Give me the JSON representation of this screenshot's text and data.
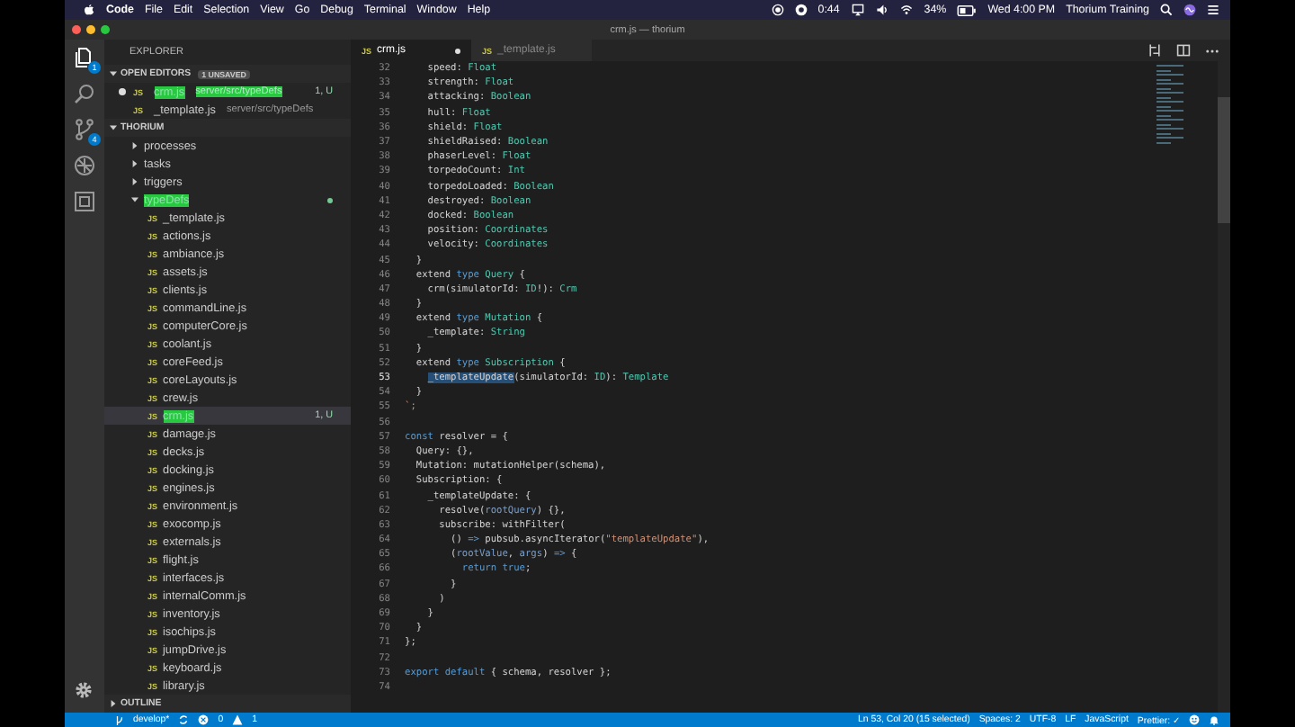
{
  "menubar": {
    "app": "Code",
    "menus": [
      "File",
      "Edit",
      "Selection",
      "View",
      "Go",
      "Debug",
      "Terminal",
      "Window",
      "Help"
    ],
    "timer": "0:44",
    "battery": "34%",
    "clock": "Wed 4:00 PM",
    "user": "Thorium Training"
  },
  "window": {
    "title": "crm.js — thorium"
  },
  "activity_bar": {
    "explorer_badge": "1",
    "source_control_badge": "4"
  },
  "sidebar": {
    "title": "EXPLORER",
    "open_editors": {
      "label": "OPEN EDITORS",
      "expanded": true,
      "badge": "1 UNSAVED",
      "items": [
        {
          "icon": "JS",
          "name": "crm.js",
          "path": "server/src/typeDefs",
          "dirty": true,
          "untracked": true,
          "status": "1, U"
        },
        {
          "icon": "JS",
          "name": "_template.js",
          "path": "server/src/typeDefs",
          "dirty": false,
          "untracked": false
        }
      ]
    },
    "project": {
      "label": "THORIUM",
      "expanded": true,
      "children": [
        {
          "name": "processes",
          "expanded": false,
          "untracked": false
        },
        {
          "name": "tasks",
          "expanded": false,
          "untracked": false
        },
        {
          "name": "triggers",
          "expanded": false,
          "untracked": false
        },
        {
          "name": "typeDefs",
          "expanded": true,
          "untracked": true,
          "children": [
            {
              "icon": "JS",
              "name": "_template.js",
              "selected": false,
              "untracked": false
            },
            {
              "icon": "JS",
              "name": "actions.js",
              "selected": false,
              "untracked": false
            },
            {
              "icon": "JS",
              "name": "ambiance.js",
              "selected": false,
              "untracked": false
            },
            {
              "icon": "JS",
              "name": "assets.js",
              "selected": false,
              "untracked": false
            },
            {
              "icon": "JS",
              "name": "clients.js",
              "selected": false,
              "untracked": false
            },
            {
              "icon": "JS",
              "name": "commandLine.js",
              "selected": false,
              "untracked": false
            },
            {
              "icon": "JS",
              "name": "computerCore.js",
              "selected": false,
              "untracked": false
            },
            {
              "icon": "JS",
              "name": "coolant.js",
              "selected": false,
              "untracked": false
            },
            {
              "icon": "JS",
              "name": "coreFeed.js",
              "selected": false,
              "untracked": false
            },
            {
              "icon": "JS",
              "name": "coreLayouts.js",
              "selected": false,
              "untracked": false
            },
            {
              "icon": "JS",
              "name": "crew.js",
              "selected": false,
              "untracked": false
            },
            {
              "icon": "JS",
              "name": "crm.js",
              "selected": true,
              "untracked": true,
              "status": "1, U"
            },
            {
              "icon": "JS",
              "name": "damage.js",
              "selected": false,
              "untracked": false
            },
            {
              "icon": "JS",
              "name": "decks.js",
              "selected": false,
              "untracked": false
            },
            {
              "icon": "JS",
              "name": "docking.js",
              "selected": false,
              "untracked": false
            },
            {
              "icon": "JS",
              "name": "engines.js",
              "selected": false,
              "untracked": false
            },
            {
              "icon": "JS",
              "name": "environment.js",
              "selected": false,
              "untracked": false
            },
            {
              "icon": "JS",
              "name": "exocomp.js",
              "selected": false,
              "untracked": false
            },
            {
              "icon": "JS",
              "name": "externals.js",
              "selected": false,
              "untracked": false
            },
            {
              "icon": "JS",
              "name": "flight.js",
              "selected": false,
              "untracked": false
            },
            {
              "icon": "JS",
              "name": "interfaces.js",
              "selected": false,
              "untracked": false
            },
            {
              "icon": "JS",
              "name": "internalComm.js",
              "selected": false,
              "untracked": false
            },
            {
              "icon": "JS",
              "name": "inventory.js",
              "selected": false,
              "untracked": false
            },
            {
              "icon": "JS",
              "name": "isochips.js",
              "selected": false,
              "untracked": false
            },
            {
              "icon": "JS",
              "name": "jumpDrive.js",
              "selected": false,
              "untracked": false
            },
            {
              "icon": "JS",
              "name": "keyboard.js",
              "selected": false,
              "untracked": false
            },
            {
              "icon": "JS",
              "name": "library.js",
              "selected": false,
              "untracked": false
            }
          ]
        }
      ]
    },
    "outline": {
      "label": "OUTLINE",
      "expanded": false
    }
  },
  "tabs": [
    {
      "icon": "JS",
      "label": "crm.js",
      "selected": true,
      "dirty": true
    },
    {
      "icon": "JS",
      "label": "_template.js",
      "selected": false,
      "dirty": false
    }
  ],
  "editor": {
    "lines": [
      {
        "number": "32",
        "current": false,
        "tokens": [
          {
            "text": "    speed: ",
            "kind": "plain"
          },
          {
            "text": "Float",
            "kind": "type"
          }
        ]
      },
      {
        "number": "33",
        "current": false,
        "tokens": [
          {
            "text": "    strength: ",
            "kind": "plain"
          },
          {
            "text": "Float",
            "kind": "type"
          }
        ]
      },
      {
        "number": "34",
        "current": false,
        "tokens": [
          {
            "text": "    attacking: ",
            "kind": "plain"
          },
          {
            "text": "Boolean",
            "kind": "type"
          }
        ]
      },
      {
        "number": "35",
        "current": false,
        "tokens": [
          {
            "text": "    hull: ",
            "kind": "plain"
          },
          {
            "text": "Float",
            "kind": "type"
          }
        ]
      },
      {
        "number": "36",
        "current": false,
        "tokens": [
          {
            "text": "    shield: ",
            "kind": "plain"
          },
          {
            "text": "Float",
            "kind": "type"
          }
        ]
      },
      {
        "number": "37",
        "current": false,
        "tokens": [
          {
            "text": "    shieldRaised: ",
            "kind": "plain"
          },
          {
            "text": "Boolean",
            "kind": "type"
          }
        ]
      },
      {
        "number": "38",
        "current": false,
        "tokens": [
          {
            "text": "    phaserLevel: ",
            "kind": "plain"
          },
          {
            "text": "Float",
            "kind": "type"
          }
        ]
      },
      {
        "number": "39",
        "current": false,
        "tokens": [
          {
            "text": "    torpedoCount: ",
            "kind": "plain"
          },
          {
            "text": "Int",
            "kind": "type"
          }
        ]
      },
      {
        "number": "40",
        "current": false,
        "tokens": [
          {
            "text": "    torpedoLoaded: ",
            "kind": "plain"
          },
          {
            "text": "Boolean",
            "kind": "type"
          }
        ]
      },
      {
        "number": "41",
        "current": false,
        "tokens": [
          {
            "text": "    destroyed: ",
            "kind": "plain"
          },
          {
            "text": "Boolean",
            "kind": "type"
          }
        ]
      },
      {
        "number": "42",
        "current": false,
        "tokens": [
          {
            "text": "    docked: ",
            "kind": "plain"
          },
          {
            "text": "Boolean",
            "kind": "type"
          }
        ]
      },
      {
        "number": "43",
        "current": false,
        "tokens": [
          {
            "text": "    position: ",
            "kind": "plain"
          },
          {
            "text": "Coordinates",
            "kind": "type"
          }
        ]
      },
      {
        "number": "44",
        "current": false,
        "tokens": [
          {
            "text": "    velocity: ",
            "kind": "plain"
          },
          {
            "text": "Coordinates",
            "kind": "type"
          }
        ]
      },
      {
        "number": "45",
        "current": false,
        "tokens": [
          {
            "text": "  }",
            "kind": "plain"
          }
        ]
      },
      {
        "number": "46",
        "current": false,
        "tokens": [
          {
            "text": "  extend ",
            "kind": "plain"
          },
          {
            "text": "type",
            "kind": "keyword"
          },
          {
            "text": " Query",
            "kind": "type"
          },
          {
            "text": " {",
            "kind": "plain"
          }
        ]
      },
      {
        "number": "47",
        "current": false,
        "tokens": [
          {
            "text": "    crm(simulatorId: ",
            "kind": "plain"
          },
          {
            "text": "ID",
            "kind": "type"
          },
          {
            "text": "!): ",
            "kind": "plain"
          },
          {
            "text": "Crm",
            "kind": "type"
          }
        ]
      },
      {
        "number": "48",
        "current": false,
        "tokens": [
          {
            "text": "  }",
            "kind": "plain"
          }
        ]
      },
      {
        "number": "49",
        "current": false,
        "tokens": [
          {
            "text": "  extend ",
            "kind": "plain"
          },
          {
            "text": "type",
            "kind": "keyword"
          },
          {
            "text": " Mutation",
            "kind": "type"
          },
          {
            "text": " {",
            "kind": "plain"
          }
        ]
      },
      {
        "number": "50",
        "current": false,
        "tokens": [
          {
            "text": "    _template: ",
            "kind": "plain"
          },
          {
            "text": "String",
            "kind": "type"
          }
        ]
      },
      {
        "number": "51",
        "current": false,
        "tokens": [
          {
            "text": "  }",
            "kind": "plain"
          }
        ]
      },
      {
        "number": "52",
        "current": false,
        "tokens": [
          {
            "text": "  extend ",
            "kind": "plain"
          },
          {
            "text": "type",
            "kind": "keyword"
          },
          {
            "text": " Subscription",
            "kind": "type"
          },
          {
            "text": " {",
            "kind": "plain"
          }
        ]
      },
      {
        "number": "53",
        "current": true,
        "tokens": [
          {
            "text": "    _templateUpdate",
            "kind": "selection"
          },
          {
            "text": "(simulatorId: ",
            "kind": "plain"
          },
          {
            "text": "ID",
            "kind": "type"
          },
          {
            "text": "): ",
            "kind": "plain"
          },
          {
            "text": "Template",
            "kind": "type"
          }
        ]
      },
      {
        "number": "54",
        "current": false,
        "tokens": [
          {
            "text": "  }",
            "kind": "plain"
          }
        ]
      },
      {
        "number": "55",
        "current": false,
        "tokens": [
          {
            "text": "`;",
            "kind": "string"
          }
        ]
      },
      {
        "number": "56",
        "current": false
      },
      {
        "number": "57",
        "current": false,
        "tokens": [
          {
            "text": "const",
            "kind": "keyword"
          },
          {
            "text": " resolver = {",
            "kind": "plain"
          }
        ]
      },
      {
        "number": "58",
        "current": false,
        "tokens": [
          {
            "text": "  Query: {},",
            "kind": "plain"
          }
        ]
      },
      {
        "number": "59",
        "current": false,
        "tokens": [
          {
            "text": "  Mutation: mutationHelper(schema),",
            "kind": "plain"
          }
        ]
      },
      {
        "number": "60",
        "current": false,
        "tokens": [
          {
            "text": "  Subscription: {",
            "kind": "plain"
          }
        ]
      },
      {
        "number": "61",
        "current": false,
        "tokens": [
          {
            "text": "    _templateUpdate: {",
            "kind": "plain"
          }
        ]
      },
      {
        "number": "62",
        "current": false,
        "tokens": [
          {
            "text": "      resolve(",
            "kind": "plain"
          },
          {
            "text": "rootQuery",
            "kind": "param"
          },
          {
            "text": ") {},",
            "kind": "plain"
          }
        ]
      },
      {
        "number": "63",
        "current": false,
        "tokens": [
          {
            "text": "      subscribe: withFilter(",
            "kind": "plain"
          }
        ]
      },
      {
        "number": "64",
        "current": false,
        "tokens": [
          {
            "text": "        () ",
            "kind": "plain"
          },
          {
            "text": "=>",
            "kind": "keyword"
          },
          {
            "text": " pubsub.asyncIterator(",
            "kind": "plain"
          },
          {
            "text": "\"templateUpdate\"",
            "kind": "string"
          },
          {
            "text": "),",
            "kind": "plain"
          }
        ]
      },
      {
        "number": "65",
        "current": false,
        "tokens": [
          {
            "text": "        (",
            "kind": "plain"
          },
          {
            "text": "rootValue",
            "kind": "param"
          },
          {
            "text": ", ",
            "kind": "plain"
          },
          {
            "text": "args",
            "kind": "param"
          },
          {
            "text": ") ",
            "kind": "plain"
          },
          {
            "text": "=>",
            "kind": "keyword"
          },
          {
            "text": " {",
            "kind": "plain"
          }
        ]
      },
      {
        "number": "66",
        "current": false,
        "tokens": [
          {
            "text": "          return true",
            "kind": "keyword"
          },
          {
            "text": ";",
            "kind": "plain"
          }
        ]
      },
      {
        "number": "67",
        "current": false,
        "tokens": [
          {
            "text": "        }",
            "kind": "plain"
          }
        ]
      },
      {
        "number": "68",
        "current": false,
        "tokens": [
          {
            "text": "      )",
            "kind": "plain"
          }
        ]
      },
      {
        "number": "69",
        "current": false,
        "tokens": [
          {
            "text": "    }",
            "kind": "plain"
          }
        ]
      },
      {
        "number": "70",
        "current": false,
        "tokens": [
          {
            "text": "  }",
            "kind": "plain"
          }
        ]
      },
      {
        "number": "71",
        "current": false,
        "tokens": [
          {
            "text": "};",
            "kind": "plain"
          }
        ]
      },
      {
        "number": "72",
        "current": false
      },
      {
        "number": "73",
        "current": false,
        "tokens": [
          {
            "text": "export default",
            "kind": "keyword"
          },
          {
            "text": " { schema, resolver };",
            "kind": "plain"
          }
        ]
      },
      {
        "number": "74",
        "current": false
      }
    ]
  },
  "status_bar": {
    "branch": "develop*",
    "errors": "0",
    "warnings": "1",
    "position": "Ln 53, Col 20 (15 selected)",
    "indentation": "Spaces: 2",
    "encoding": "UTF-8",
    "eol": "LF",
    "language": "JavaScript",
    "formatter": "Prettier: ✓"
  }
}
